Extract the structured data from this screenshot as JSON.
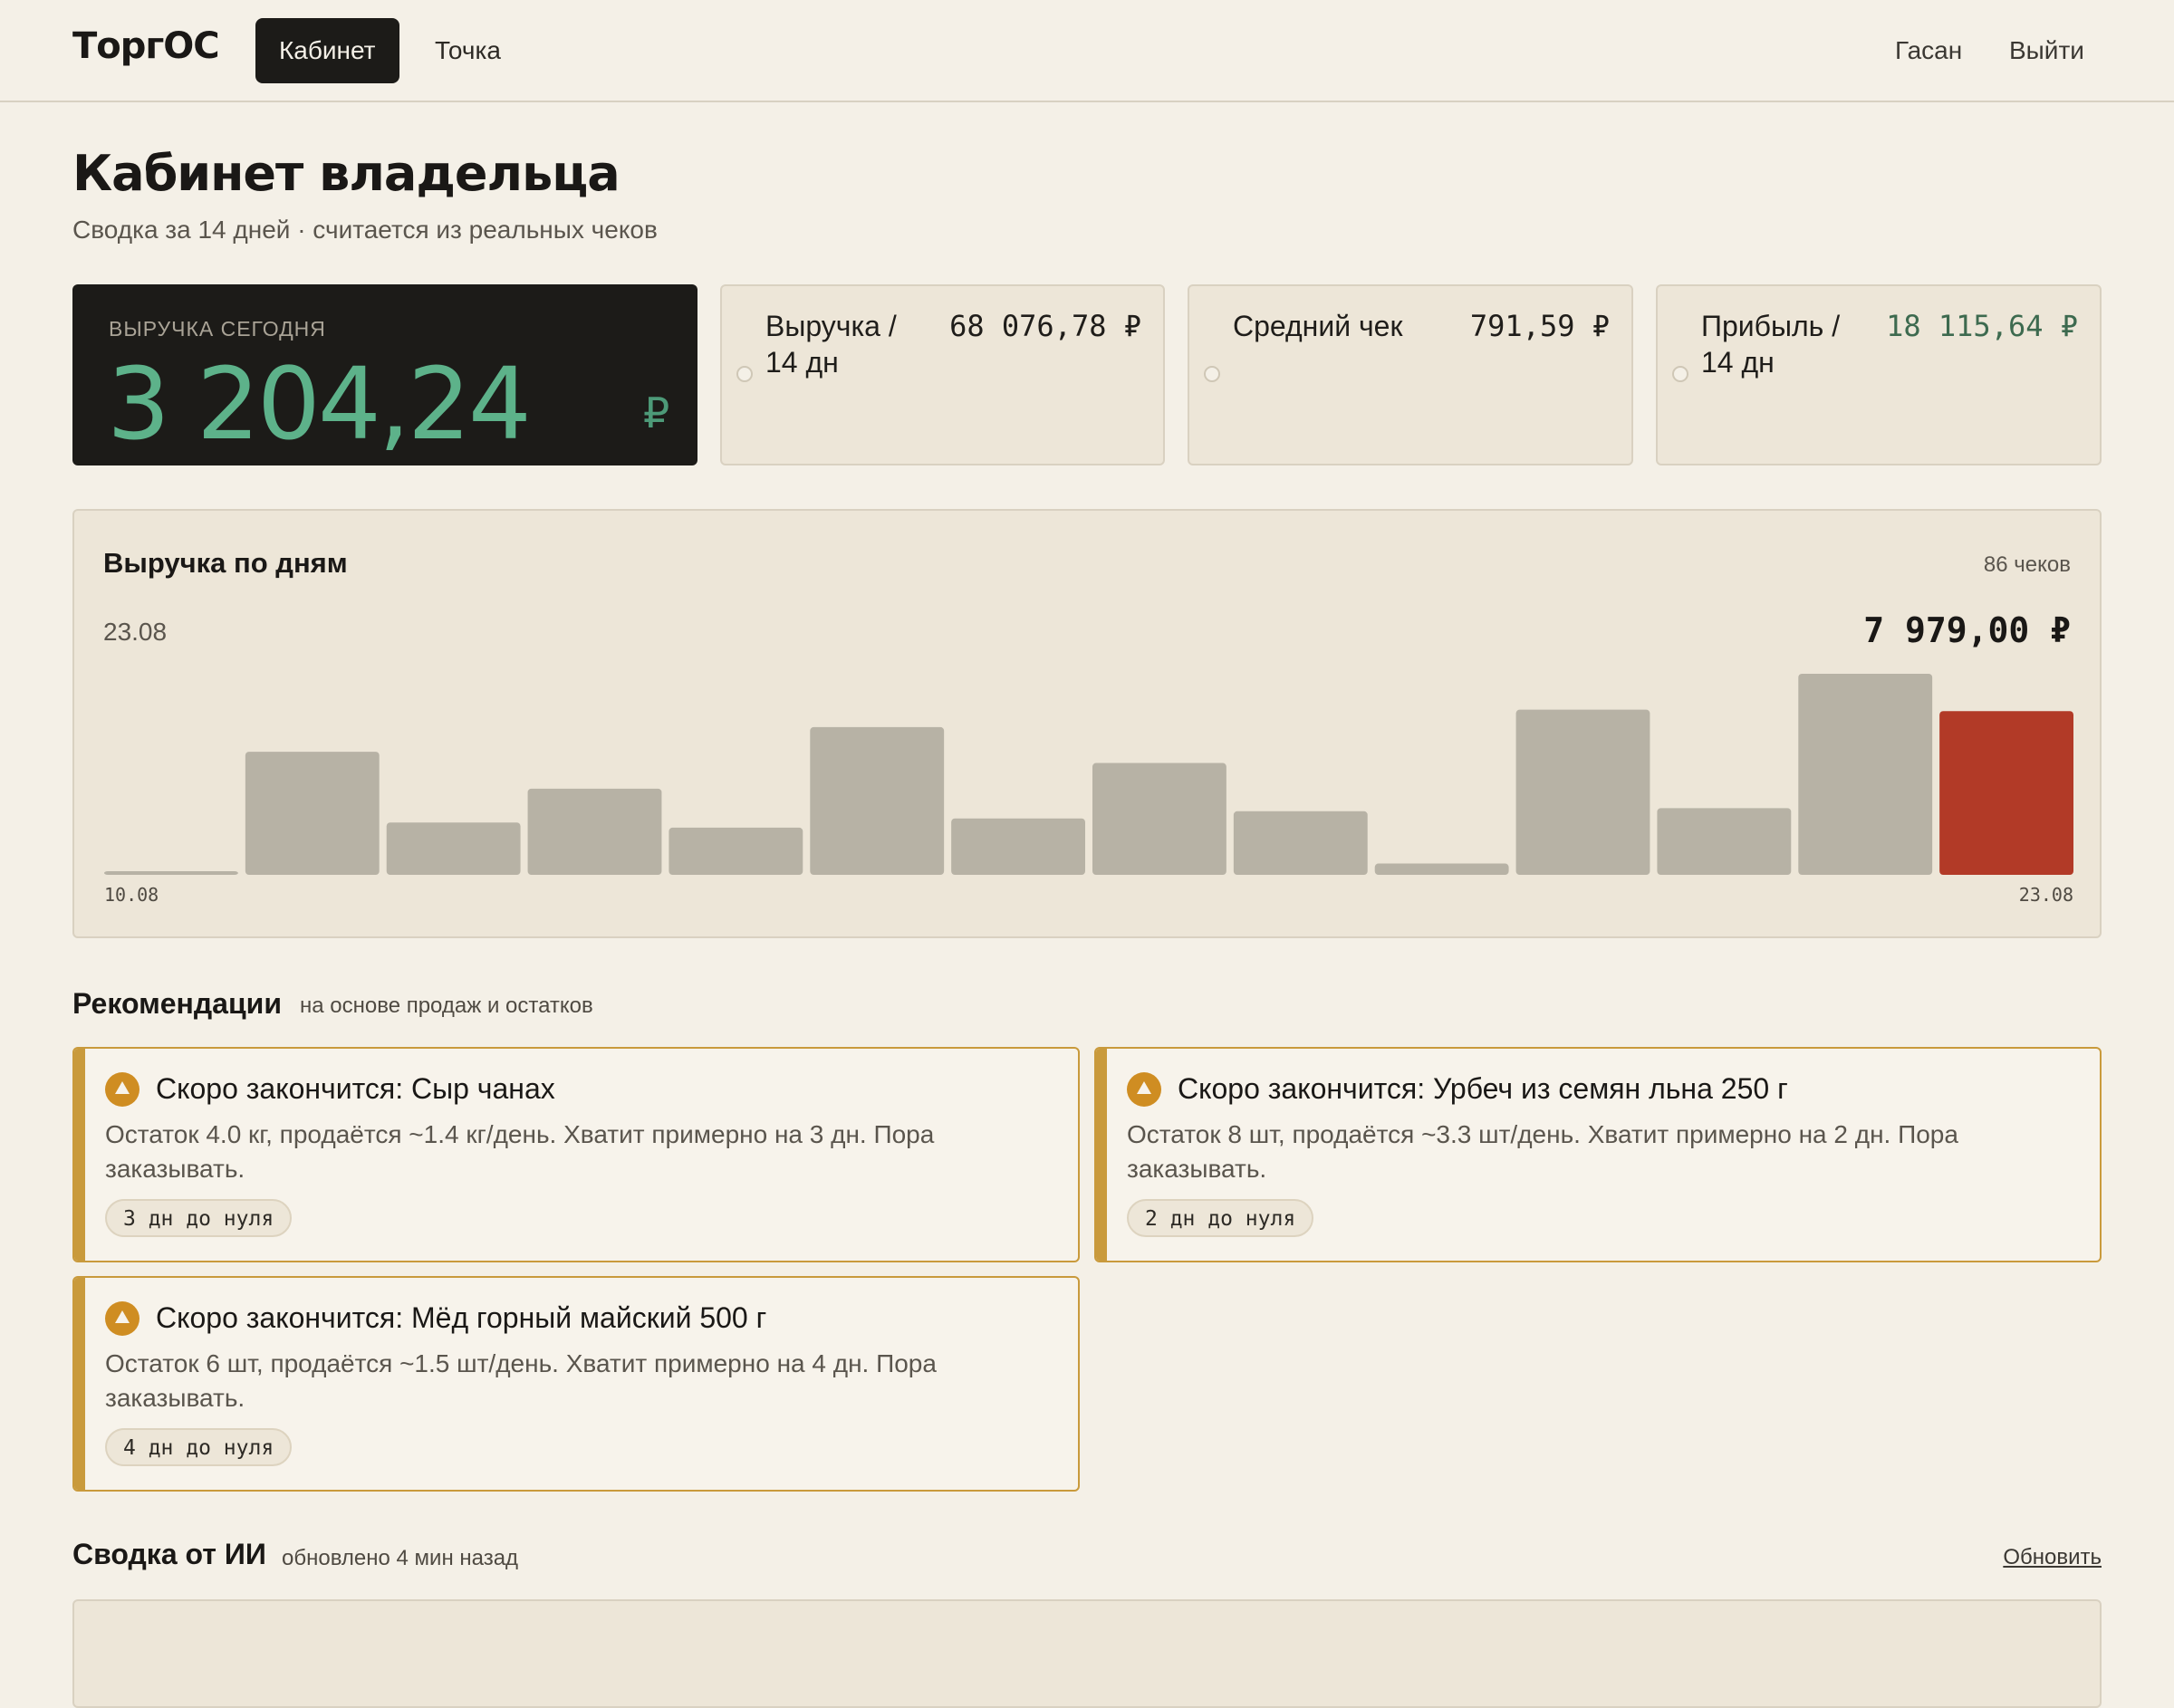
{
  "app": {
    "logo": "ТоргОС"
  },
  "nav": {
    "tabs": [
      {
        "label": "Кабинет",
        "active": true
      },
      {
        "label": "Точка",
        "active": false
      }
    ],
    "user": "Гасан",
    "logout": "Выйти"
  },
  "page": {
    "title": "Кабинет владельца",
    "subtitle": "Сводка за 14 дней · считается из реальных чеков"
  },
  "kpis": {
    "today": {
      "label": "ВЫРУЧКА СЕГОДНЯ",
      "value": "3 204,24",
      "currency": "₽"
    },
    "cards": [
      {
        "label": "Выручка /\n14 дн",
        "value": "68 076,78 ₽"
      },
      {
        "label": "Средний чек",
        "value": "791,59 ₽"
      },
      {
        "label": "Прибыль /\n14 дн",
        "value": "18 115,64 ₽"
      }
    ]
  },
  "chart": {
    "title": "Выручка по дням",
    "count": "86 чеков",
    "selected_date": "23.08",
    "selected_total": "7 979,00 ₽"
  },
  "chart_data": {
    "type": "bar",
    "categories": [
      "10.08",
      "11.08",
      "12.08",
      "13.08",
      "14.08",
      "15.08",
      "16.08",
      "17.08",
      "18.08",
      "19.08",
      "20.08",
      "21.08",
      "22.08",
      "23.08"
    ],
    "values": [
      160,
      6000,
      2550,
      4200,
      2300,
      7200,
      2750,
      5450,
      3100,
      550,
      8050,
      3250,
      9800,
      7979
    ],
    "highlight_index": 13,
    "x_tick_labels": [
      "10.08",
      "23.08"
    ],
    "ylim": [
      0,
      9800
    ],
    "grid": false,
    "colors": {
      "bar": "#b7b2a5",
      "highlight": "#b23a27"
    }
  },
  "recommendations": {
    "title": "Рекомендации",
    "subtitle": "на основе продаж и остатков",
    "items": [
      {
        "title": "Скоро закончится: Сыр чанах",
        "text": "Остаток 4.0 кг, продаётся ~1.4 кг/день. Хватит примерно на 3 дн. Пора заказывать.",
        "chip": "3 дн до нуля"
      },
      {
        "title": "Скоро закончится: Урбеч из семян льна 250 г",
        "text": "Остаток 8 шт, продаётся ~3.3 шт/день. Хватит примерно на 2 дн. Пора заказывать.",
        "chip": "2 дн до нуля"
      },
      {
        "title": "Скоро закончится: Мёд горный майский 500 г",
        "text": "Остаток 6 шт, продаётся ~1.5 шт/день. Хватит примерно на 4 дн. Пора заказывать.",
        "chip": "4 дн до нуля"
      }
    ]
  },
  "ai": {
    "title": "Сводка от ИИ",
    "updated": "обновлено 4 мин назад",
    "refresh": "Обновить"
  },
  "colors": {
    "accent_green": "#5db28a",
    "warning": "#c99a3c",
    "highlight_bar": "#b23a27"
  }
}
